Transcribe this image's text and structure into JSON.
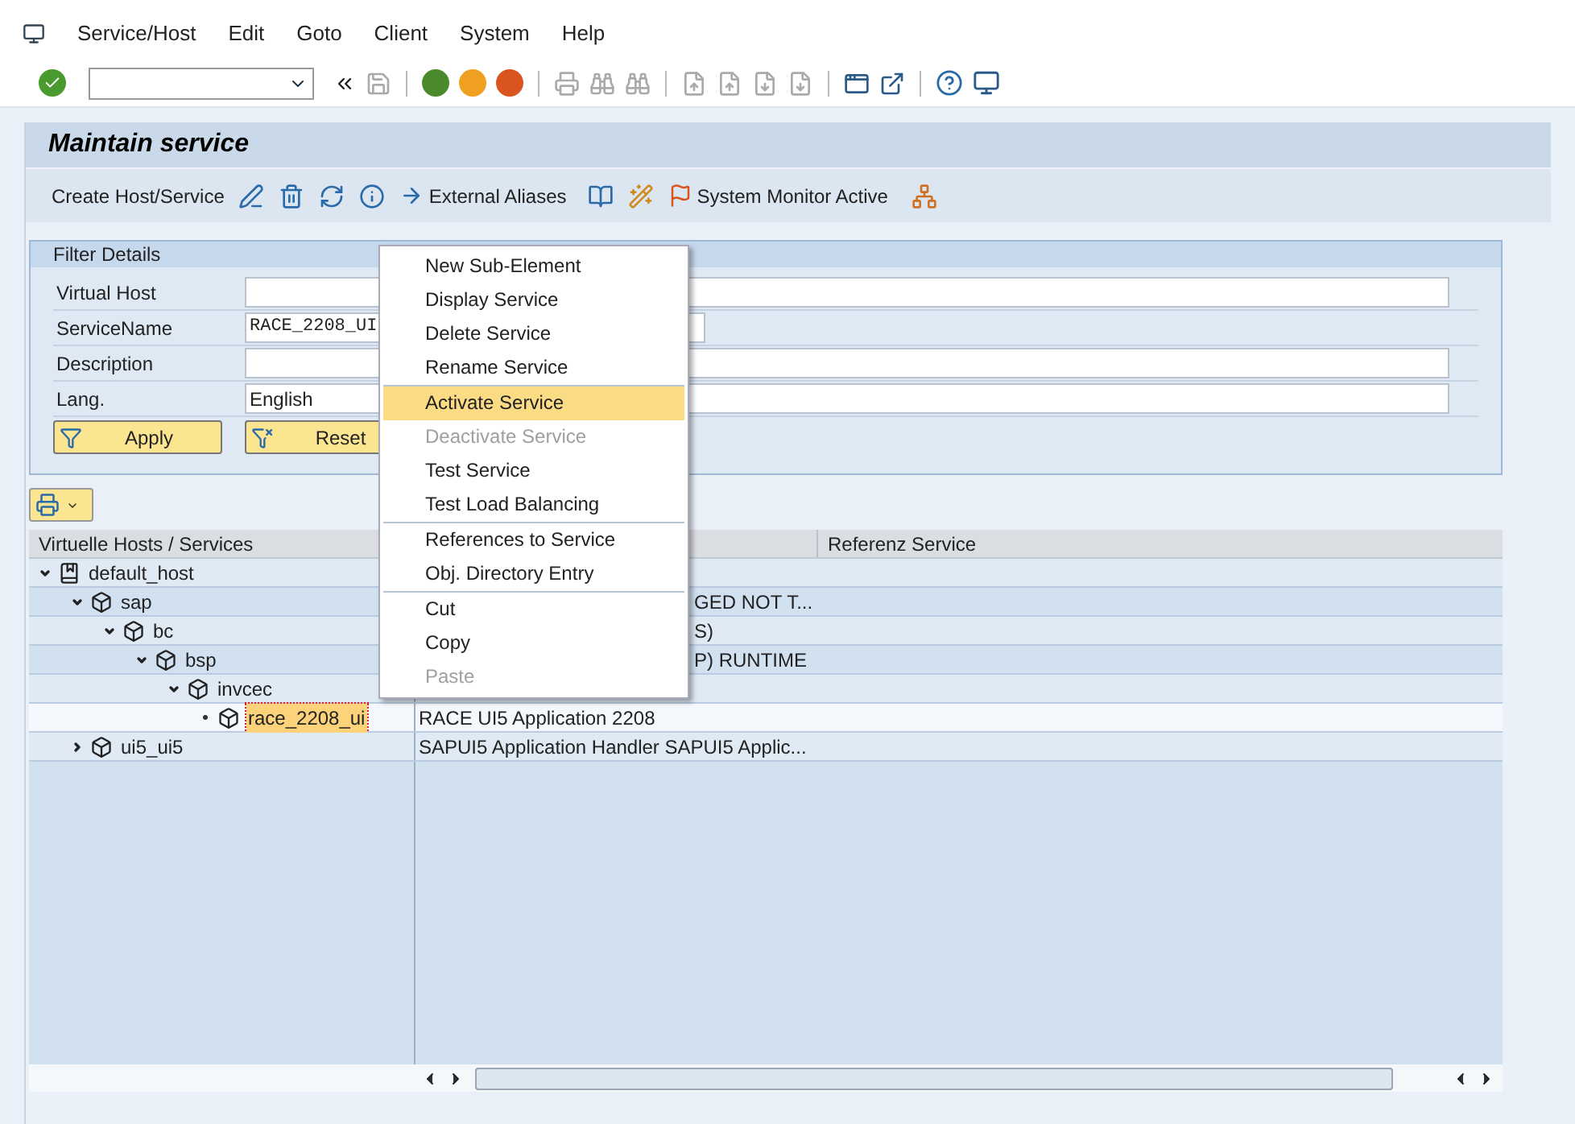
{
  "menubar": {
    "items": [
      "Service/Host",
      "Edit",
      "Goto",
      "Client",
      "System",
      "Help"
    ]
  },
  "title": "Maintain service",
  "app_toolbar": {
    "buttons": [
      "Create Host/Service",
      "External Aliases",
      "System Monitor Active"
    ]
  },
  "filter": {
    "title": "Filter Details",
    "fields": [
      {
        "label": "Virtual Host"
      },
      {
        "label": "ServiceName",
        "value": "RACE_2208_UI"
      },
      {
        "label": "Description"
      },
      {
        "label": "Lang.",
        "value": "English"
      }
    ],
    "buttons": [
      "Apply",
      "Reset"
    ]
  },
  "tree": {
    "columns": [
      "Virtuelle Hosts / Services",
      "Referenz Service"
    ],
    "nodes": [
      {
        "name": "default_host",
        "expanded": true,
        "children": [
          {
            "name": "sap",
            "expanded": true,
            "description": "GED NOT T...",
            "children": [
              {
                "name": "bc",
                "expanded": true,
                "description": "S)",
                "children": [
                  {
                    "name": "bsp",
                    "expanded": true,
                    "description": "P) RUNTIME",
                    "children": [
                      {
                        "name": "invcec",
                        "expanded": true,
                        "children": [
                          {
                            "name": "race_2208_ui",
                            "selected": true,
                            "description": "RACE UI5 Application 2208"
                          }
                        ]
                      }
                    ]
                  }
                ]
              }
            ]
          },
          {
            "name": "ui5_ui5",
            "expanded": false,
            "selected": false,
            "description": "SAPUI5 Application Handler SAPUI5 Applic..."
          }
        ]
      }
    ]
  },
  "context_menu": {
    "groups": [
      [
        {
          "label": "New Sub-Element",
          "disabled": false,
          "selected": false
        },
        {
          "label": "Display Service",
          "disabled": false,
          "selected": false
        },
        {
          "label": "Delete Service",
          "disabled": false,
          "selected": false
        },
        {
          "label": "Rename Service",
          "disabled": false,
          "selected": false
        }
      ],
      [
        {
          "label": "Activate Service",
          "disabled": false,
          "selected": true
        },
        {
          "label": "Deactivate Service",
          "disabled": true,
          "selected": false
        },
        {
          "label": "Test Service",
          "disabled": false,
          "selected": false
        },
        {
          "label": "Test Load Balancing",
          "disabled": false,
          "selected": false
        }
      ],
      [
        {
          "label": "References to Service",
          "disabled": false,
          "selected": false
        },
        {
          "label": "Obj. Directory Entry",
          "disabled": false,
          "selected": false
        }
      ],
      [
        {
          "label": "Cut",
          "disabled": false,
          "selected": false
        },
        {
          "label": "Copy",
          "disabled": false,
          "selected": false
        },
        {
          "label": "Paste",
          "disabled": true,
          "selected": false
        }
      ]
    ]
  }
}
